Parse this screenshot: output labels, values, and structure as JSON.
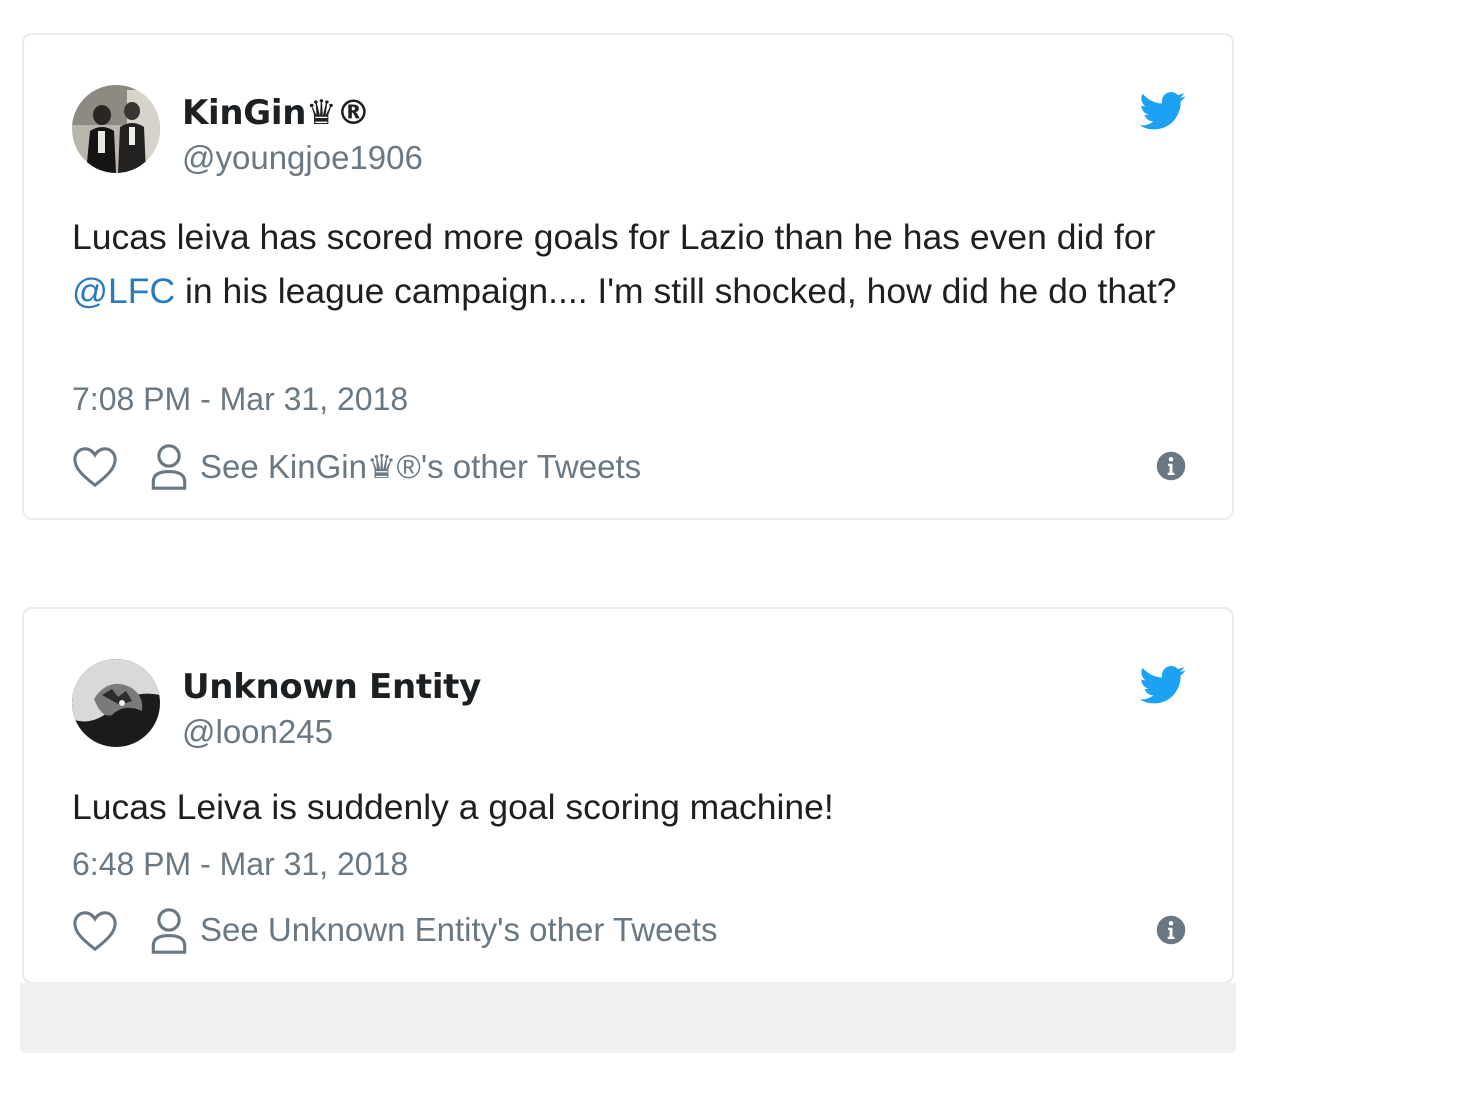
{
  "tweets": [
    {
      "display_name": "KinGin♛®",
      "handle": "@youngjoe1906",
      "text_before": "Lucas leiva has scored more goals for Lazio than he has even did for ",
      "mention": "@LFC",
      "text_after": " in his league campaign.... I'm still shocked, how did he do that?",
      "timestamp": "7:08 PM - Mar 31, 2018",
      "other_tweets_label": "See KinGin♛®'s other Tweets"
    },
    {
      "display_name": "Unknown Entity",
      "handle": "@loon245",
      "text_before": "Lucas Leiva is suddenly a goal scoring machine!",
      "mention": "",
      "text_after": "",
      "timestamp": "6:48 PM - Mar 31, 2018",
      "other_tweets_label": "See Unknown Entity's other Tweets"
    }
  ],
  "icons": {
    "brand": "twitter-bird-icon",
    "like": "heart-icon",
    "profile": "person-icon",
    "info": "info-icon"
  },
  "colors": {
    "twitter_blue": "#1da1f2",
    "mention_blue": "#2b7bb9",
    "primary_text": "#1c2022",
    "secondary_text": "#697882",
    "card_border": "#e6ecf0"
  }
}
